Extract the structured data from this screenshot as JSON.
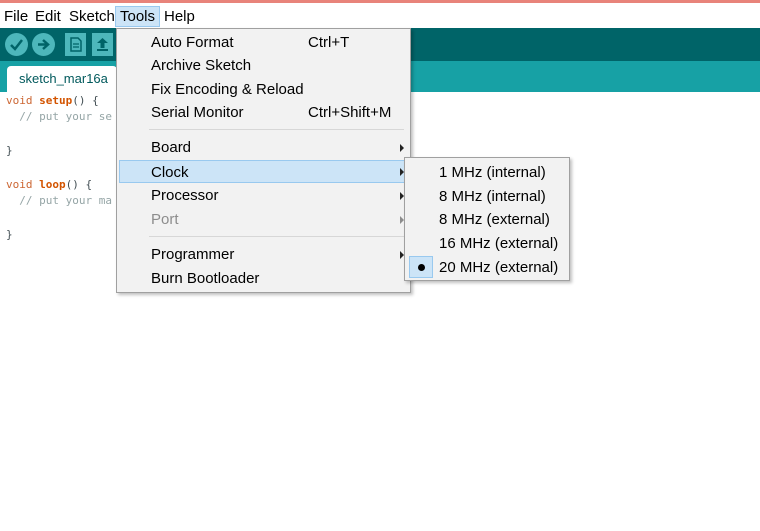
{
  "menubar": {
    "items": [
      {
        "label": "File"
      },
      {
        "label": "Edit"
      },
      {
        "label": "Sketch"
      },
      {
        "label": "Tools"
      },
      {
        "label": "Help"
      }
    ]
  },
  "toolbar": {
    "buttons": [
      "verify-icon",
      "upload-icon",
      "new-icon",
      "open-icon"
    ]
  },
  "tab": {
    "label": "sketch_mar16a"
  },
  "code": {
    "line1_kw": "void",
    "line1_fn": "setup",
    "line1_rest": "() {",
    "line2_comment": "  // put your se",
    "line3": "}",
    "line4_kw": "void",
    "line4_fn": "loop",
    "line4_rest": "() {",
    "line5_comment": "  // put your ma",
    "line6": "}"
  },
  "tools_menu": {
    "items": [
      {
        "label": "Auto Format",
        "shortcut": "Ctrl+T"
      },
      {
        "label": "Archive Sketch"
      },
      {
        "label": "Fix Encoding & Reload"
      },
      {
        "label": "Serial Monitor",
        "shortcut": "Ctrl+Shift+M"
      },
      {
        "label": "Board"
      },
      {
        "label": "Clock"
      },
      {
        "label": "Processor"
      },
      {
        "label": "Port"
      },
      {
        "label": "Programmer"
      },
      {
        "label": "Burn Bootloader"
      }
    ]
  },
  "clock_menu": {
    "items": [
      {
        "label": "1 MHz (internal)"
      },
      {
        "label": "8 MHz (internal)"
      },
      {
        "label": "8 MHz (external)"
      },
      {
        "label": "16 MHz (external)"
      },
      {
        "label": "20 MHz (external)"
      }
    ],
    "selected": "20 MHz (external)"
  }
}
